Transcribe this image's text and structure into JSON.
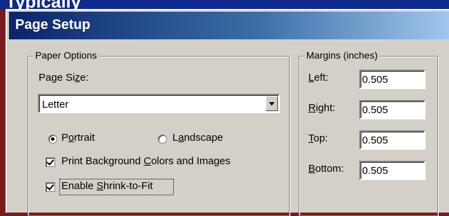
{
  "background_title": {
    "text": "Typically"
  },
  "dialog": {
    "title": "Page Setup"
  },
  "paper_options": {
    "legend": "Paper Options",
    "page_size_label_pre": "Page Si",
    "page_size_label_accel": "z",
    "page_size_label_post": "e:",
    "page_size_value": "Letter",
    "orientation": {
      "portrait_pre": "P",
      "portrait_accel": "o",
      "portrait_post": "rtrait",
      "landscape_pre": "L",
      "landscape_accel": "a",
      "landscape_post": "ndscape",
      "selected": "portrait"
    },
    "print_background": {
      "pre": "Print Background ",
      "accel": "C",
      "post": "olors and Images",
      "checked": true
    },
    "shrink_to_fit": {
      "pre": "Enable ",
      "accel": "S",
      "post": "hrink-to-Fit",
      "checked": true
    }
  },
  "margins": {
    "legend": "Margins (inches)",
    "left_accel": "L",
    "left_rest": "eft:",
    "left_value": "0.505",
    "right_accel": "R",
    "right_rest": "ight:",
    "right_value": "0.505",
    "top_accel": "T",
    "top_rest": "op:",
    "top_value": "0.505",
    "bottom_pre": "B",
    "bottom_accel": "o",
    "bottom_rest": "ttom:",
    "bottom_value": "0.505"
  },
  "colors": {
    "title_gradient_start": "#0a246a",
    "title_gradient_end": "#a6caf0",
    "dialog_face": "#d4d0c8",
    "outer_frame": "#7a1c1c"
  }
}
